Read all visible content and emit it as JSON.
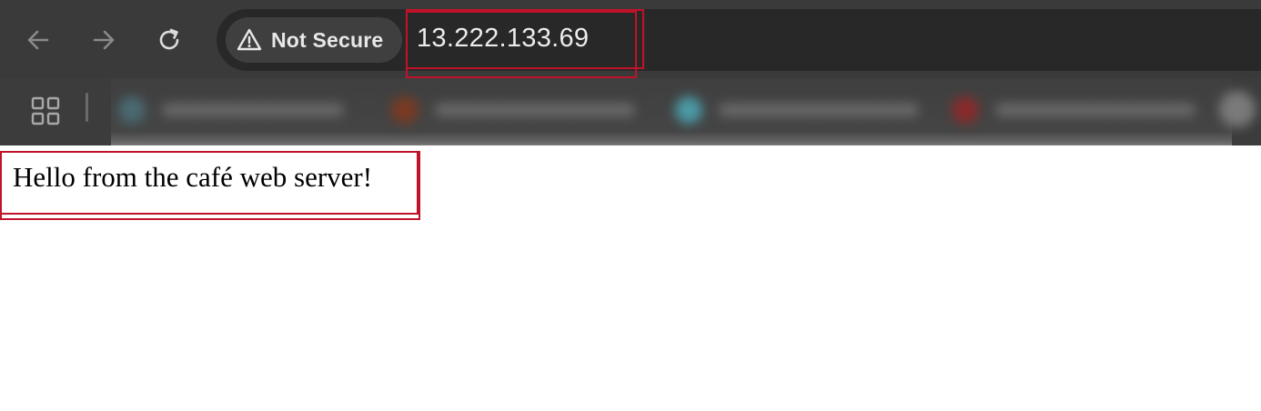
{
  "browser": {
    "toolbar": {
      "back_icon": "arrow-left-icon",
      "forward_icon": "arrow-right-icon",
      "reload_icon": "reload-icon"
    },
    "omnibox": {
      "security_label": "Not Secure",
      "security_icon": "warning-triangle-icon",
      "url": "13.222.133.69"
    },
    "bookmarks_bar": {
      "apps_icon": "apps-grid-icon",
      "items_obscured": true
    },
    "colors": {
      "toolbar_bg": "#3a3a3a",
      "omnibox_bg": "#282828",
      "highlight": "#c0132a"
    }
  },
  "page": {
    "body_text": "Hello from the café web server!"
  }
}
